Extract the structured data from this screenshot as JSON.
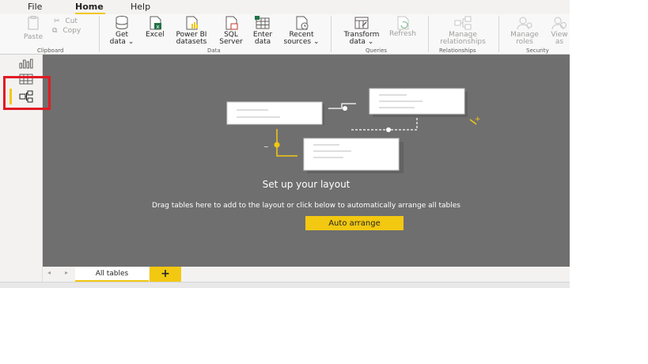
{
  "menu": {
    "tabs": [
      {
        "label": "File"
      },
      {
        "label": "Home"
      },
      {
        "label": "Help"
      }
    ]
  },
  "ribbon": {
    "clipboard": {
      "paste": "Paste",
      "cut": "Cut",
      "copy": "Copy",
      "group": "Clipboard"
    },
    "data": {
      "get_data": [
        "Get",
        "data"
      ],
      "excel": "Excel",
      "power_bi": [
        "Power BI",
        "datasets"
      ],
      "sql": [
        "SQL",
        "Server"
      ],
      "enter": [
        "Enter",
        "data"
      ],
      "recent": [
        "Recent",
        "sources"
      ],
      "group": "Data"
    },
    "queries": {
      "transform": [
        "Transform",
        "data"
      ],
      "refresh": "Refresh",
      "group": "Queries"
    },
    "relationships": {
      "manage": [
        "Manage",
        "relationships"
      ],
      "group": "Relationships"
    },
    "security": {
      "manage_roles": [
        "Manage",
        "roles"
      ],
      "view_as": [
        "View",
        "as"
      ],
      "group": "Security"
    }
  },
  "canvas": {
    "title": "Set up your layout",
    "description": "Drag tables here to add to the layout or click below to automatically arrange all tables",
    "auto_arrange": "Auto arrange"
  },
  "bottom": {
    "prev_arrow": "◂",
    "next_arrow": "▸",
    "page_tab": "All tables",
    "add_tab": "+"
  },
  "colors": {
    "accent": "#f2c811",
    "canvas": "#6f6f6f",
    "highlight": "#e01b24"
  },
  "icons": {
    "report_view": "bar-chart-icon",
    "data_view": "table-grid-icon",
    "model_view": "model-diagram-icon"
  }
}
